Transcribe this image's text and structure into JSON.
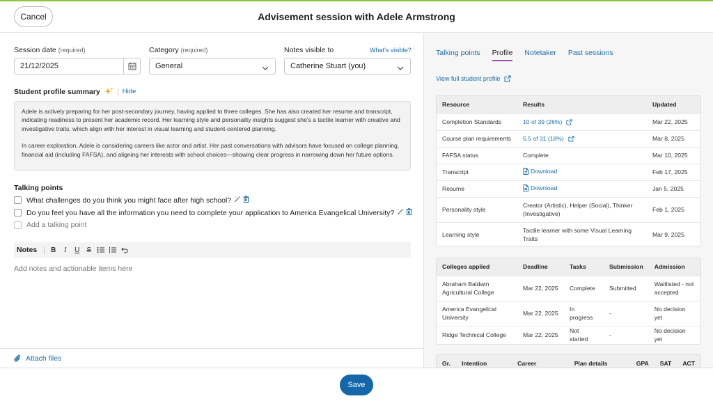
{
  "header": {
    "cancel_label": "Cancel",
    "title": "Advisement session with Adele Armstrong"
  },
  "form": {
    "session_date_label": "Session date",
    "session_date_req": "(required)",
    "session_date_value": "21/12/2025",
    "category_label": "Category",
    "category_req": "(required)",
    "category_value": "General",
    "visible_label": "Notes visible to",
    "whats_visible_link": "What's visible?",
    "visible_value": "Catherine Stuart (you)"
  },
  "summary": {
    "heading": "Student profile summary",
    "hide_link": "Hide",
    "paragraphs": [
      "Adele is actively preparing for her post-secondary journey, having applied to three colleges. She has also created her resume and transcript, indicating readiness to present her academic record. Her learning style and personality insights suggest she's a tactile learner with creative and investigative traits, which align with her interest in visual learning and student-centered planning.",
      "In career exploration, Adele is considering careers like actor and artist. Her past conversations with advisors have focused on college planning, financial aid (including FAFSA), and aligning her interests with school choices—showing clear progress in narrowing down her future options."
    ]
  },
  "talking_points": {
    "heading": "Talking points",
    "items": [
      "What challenges do you think you might face after high school?",
      "Do you feel you have all the information you need to complete your application to America Evangelical University?"
    ],
    "add_placeholder": "Add a talking point"
  },
  "notes": {
    "label": "Notes",
    "toolbar": [
      "B",
      "I",
      "U",
      "S"
    ],
    "placeholder": "Add notes and actionable items here"
  },
  "attach_label": "Attach files",
  "save_label": "Save",
  "right": {
    "tabs": [
      "Talking points",
      "Profile",
      "Notetaker",
      "Past sessions"
    ],
    "active_tab": "Profile",
    "view_profile_link": "View full student profile",
    "resources": {
      "headers": [
        "Resource",
        "Results",
        "Updated"
      ],
      "rows": [
        {
          "resource": "Completion Standards",
          "result": "10 of 39 (26%)",
          "updated": "Mar 22, 2025",
          "kind": "link"
        },
        {
          "resource": "Course plan requirements",
          "result": "5.5 of 31 (18%)",
          "updated": "Mar 8, 2025",
          "kind": "link"
        },
        {
          "resource": "FAFSA status",
          "result": "Complete",
          "updated": "Mar 10, 2025",
          "kind": "text"
        },
        {
          "resource": "Transcript",
          "result": "Download",
          "updated": "Feb 17, 2025",
          "kind": "download"
        },
        {
          "resource": "Resume",
          "result": "Download",
          "updated": "Jan 5, 2025",
          "kind": "download"
        },
        {
          "resource": "Personality style",
          "result": "Creator (Artistic), Helper (Social), Thinker (Investigative)",
          "updated": "Feb 1, 2025",
          "kind": "text"
        },
        {
          "resource": "Learning style",
          "result": "Tactile learner with some Visual Learning Traits",
          "updated": "Mar 9, 2025",
          "kind": "text"
        }
      ]
    },
    "colleges": {
      "headers": [
        "Colleges applied",
        "Deadline",
        "Tasks",
        "Submission",
        "Admission"
      ],
      "rows": [
        {
          "college": "Abraham Baldwin Agricultural College",
          "deadline": "Mar 22, 2025",
          "tasks": "Complete",
          "submission": "Submitted",
          "admission": "Waitlisted - not accepted"
        },
        {
          "college": "America Evangelical University",
          "deadline": "Mar 22, 2025",
          "tasks": "In progress",
          "submission": "-",
          "admission": "No decision yet"
        },
        {
          "college": "Ridge Technical College",
          "deadline": "Mar 22, 2025",
          "tasks": "Not started",
          "submission": "-",
          "admission": "No decision yet"
        }
      ]
    },
    "plans": {
      "headers": [
        "Gr.",
        "Intention",
        "Career",
        "Plan details",
        "GPA",
        "SAT",
        "ACT"
      ]
    }
  }
}
